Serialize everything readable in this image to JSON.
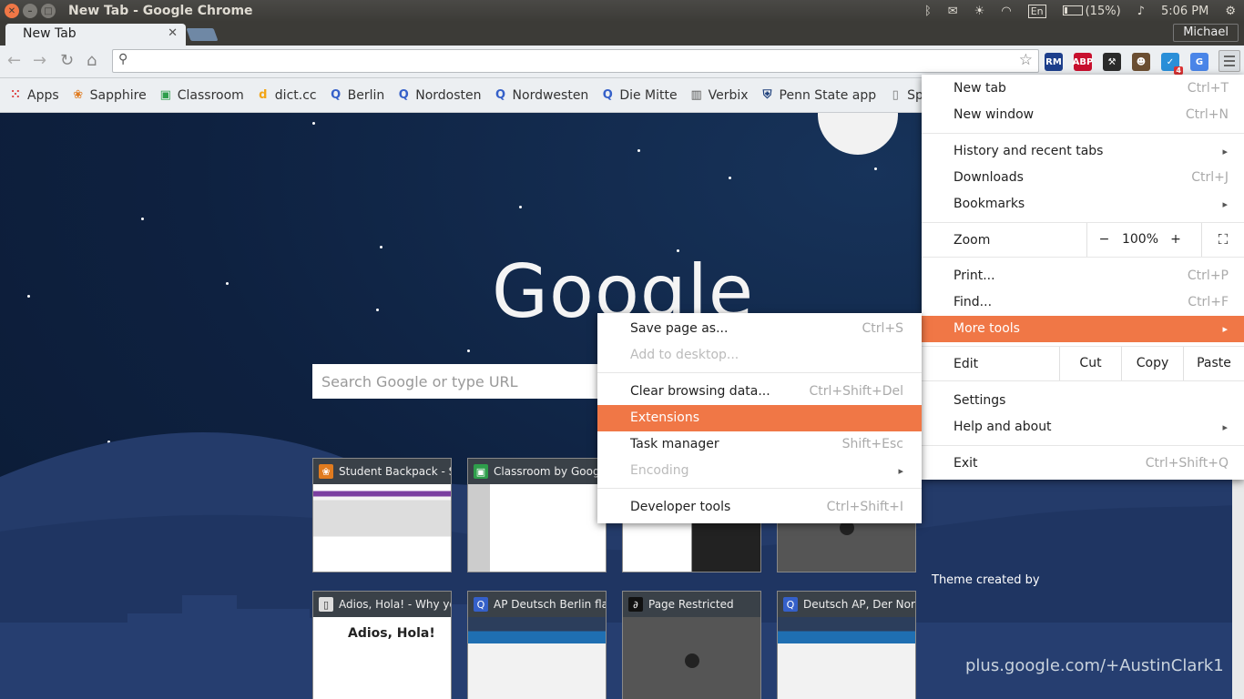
{
  "os_panel": {
    "window_title": "New Tab - Google Chrome",
    "keyboard_layout": "En",
    "battery": "(15%)",
    "clock": "5:06 PM",
    "icons": [
      "bluetooth-icon",
      "messaging-icon",
      "brightness-icon",
      "wifi-icon",
      "keyboard-icon",
      "battery-icon",
      "volume-icon",
      "settings-gear-icon"
    ]
  },
  "tabstrip": {
    "active_tab": "New Tab",
    "profile_name": "Michael"
  },
  "toolbar": {
    "omnibox_value": "",
    "extensions": [
      {
        "name": "rm-extension-icon",
        "glyph": "RM",
        "color": "#1d3f8c"
      },
      {
        "name": "adblock-plus-icon",
        "glyph": "ABP",
        "color": "#c8102e"
      },
      {
        "name": "wrench-extension-icon",
        "glyph": "⚒",
        "color": "#2b2b2b"
      },
      {
        "name": "avatar-extension-icon",
        "glyph": "☻",
        "color": "#6b4e31"
      },
      {
        "name": "checklist-extension-icon",
        "glyph": "✓",
        "color": "#2a8fd8",
        "badge": "4"
      },
      {
        "name": "translate-extension-icon",
        "glyph": "G",
        "color": "#4a85e8"
      }
    ]
  },
  "bookmarks": [
    {
      "label": "Apps",
      "icon": "apps-grid-icon",
      "glyph": "⁙",
      "color": "#d44"
    },
    {
      "label": "Sapphire",
      "icon": "sapphire-icon",
      "glyph": "❀",
      "color": "#e07b1f"
    },
    {
      "label": "Classroom",
      "icon": "classroom-icon",
      "glyph": "▣",
      "color": "#2e9e4b"
    },
    {
      "label": "dict.cc",
      "icon": "dictcc-icon",
      "glyph": "d",
      "color": "#f2a516"
    },
    {
      "label": "Berlin",
      "icon": "quizlet-icon",
      "glyph": "Q",
      "color": "#3560c9"
    },
    {
      "label": "Nordosten",
      "icon": "quizlet-icon",
      "glyph": "Q",
      "color": "#3560c9"
    },
    {
      "label": "Nordwesten",
      "icon": "quizlet-icon",
      "glyph": "Q",
      "color": "#3560c9"
    },
    {
      "label": "Die Mitte",
      "icon": "quizlet-icon",
      "glyph": "Q",
      "color": "#3560c9"
    },
    {
      "label": "Verbix",
      "icon": "verbix-icon",
      "glyph": "▥",
      "color": "#555"
    },
    {
      "label": "Penn State app",
      "icon": "penn-state-icon",
      "glyph": "⛨",
      "color": "#1e407c"
    },
    {
      "label": "Sprit",
      "icon": "page-icon",
      "glyph": "▯",
      "color": "#777"
    }
  ],
  "ntp": {
    "logo": "Google",
    "search_placeholder": "Search Google or type URL",
    "tiles": [
      {
        "title": "Student Backpack - S",
        "glyph": "❀",
        "color": "#e07b1f"
      },
      {
        "title": "Classroom by Googl",
        "glyph": "▣",
        "color": "#2e9e4b"
      },
      {
        "title": "",
        "glyph": "",
        "color": "#888"
      },
      {
        "title": "",
        "glyph": "",
        "color": "#888"
      },
      {
        "title": "Adios, Hola! - Why yo",
        "glyph": "▯",
        "color": "#ddd"
      },
      {
        "title": "AP Deutsch Berlin fla",
        "glyph": "Q",
        "color": "#3560c9"
      },
      {
        "title": "Page Restricted",
        "glyph": "∂",
        "color": "#111"
      },
      {
        "title": "Deutsch AP, Der Nord",
        "glyph": "Q",
        "color": "#3560c9"
      }
    ],
    "adios_heading": "Adios, Hola!",
    "theme_credit": "Theme created by",
    "plus_credit": "plus.google.com/+AustinClark1"
  },
  "chrome_menu": {
    "new_tab": {
      "label": "New tab",
      "shortcut": "Ctrl+T"
    },
    "new_window": {
      "label": "New window",
      "shortcut": "Ctrl+N"
    },
    "history": {
      "label": "History and recent tabs"
    },
    "downloads": {
      "label": "Downloads",
      "shortcut": "Ctrl+J"
    },
    "bookmarks": {
      "label": "Bookmarks"
    },
    "zoom": {
      "label": "Zoom",
      "minus": "−",
      "level": "100%",
      "plus": "+"
    },
    "print": {
      "label": "Print...",
      "shortcut": "Ctrl+P"
    },
    "find": {
      "label": "Find...",
      "shortcut": "Ctrl+F"
    },
    "more_tools": {
      "label": "More tools"
    },
    "edit": {
      "label": "Edit",
      "cut": "Cut",
      "copy": "Copy",
      "paste": "Paste"
    },
    "settings": {
      "label": "Settings"
    },
    "help": {
      "label": "Help and about"
    },
    "exit": {
      "label": "Exit",
      "shortcut": "Ctrl+Shift+Q"
    },
    "highlight_color": "#f07746"
  },
  "more_tools_menu": {
    "save_page": {
      "label": "Save page as...",
      "shortcut": "Ctrl+S"
    },
    "add_to_desktop": {
      "label": "Add to desktop..."
    },
    "clear_data": {
      "label": "Clear browsing data...",
      "shortcut": "Ctrl+Shift+Del"
    },
    "extensions": {
      "label": "Extensions"
    },
    "task_manager": {
      "label": "Task manager",
      "shortcut": "Shift+Esc"
    },
    "encoding": {
      "label": "Encoding"
    },
    "dev_tools": {
      "label": "Developer tools",
      "shortcut": "Ctrl+Shift+I"
    }
  }
}
